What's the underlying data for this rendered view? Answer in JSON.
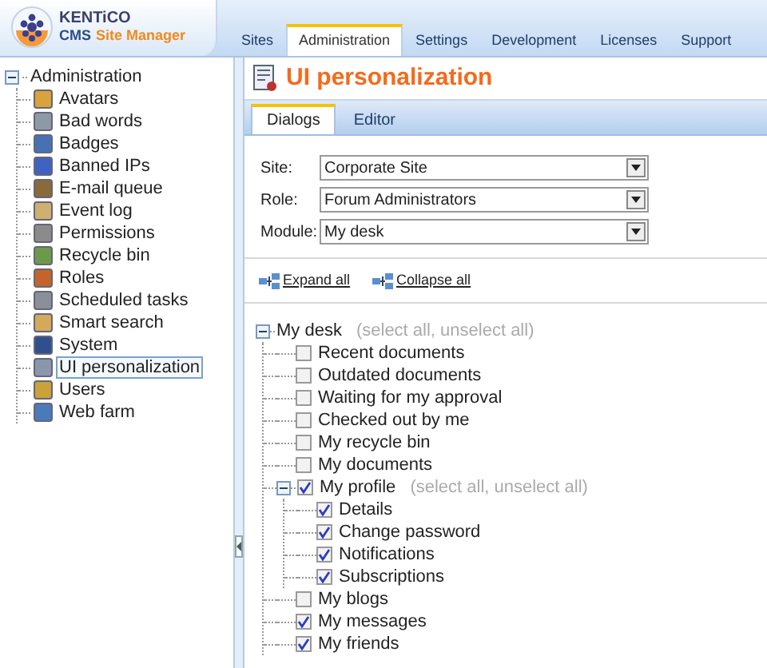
{
  "header": {
    "logo_line_1": "KENTiCO",
    "logo_line_2_a": "CMS",
    "logo_line_2_b": "Site Manager"
  },
  "main_tabs": [
    {
      "label": "Sites",
      "selected": false
    },
    {
      "label": "Administration",
      "selected": true
    },
    {
      "label": "Settings",
      "selected": false
    },
    {
      "label": "Development",
      "selected": false
    },
    {
      "label": "Licenses",
      "selected": false
    },
    {
      "label": "Support",
      "selected": false
    }
  ],
  "sidebar": {
    "root": "Administration",
    "expanded": true,
    "items": [
      {
        "label": "Avatars",
        "selected": false
      },
      {
        "label": "Bad words",
        "selected": false
      },
      {
        "label": "Badges",
        "selected": false
      },
      {
        "label": "Banned IPs",
        "selected": false
      },
      {
        "label": "E-mail queue",
        "selected": false
      },
      {
        "label": "Event log",
        "selected": false
      },
      {
        "label": "Permissions",
        "selected": false
      },
      {
        "label": "Recycle bin",
        "selected": false
      },
      {
        "label": "Roles",
        "selected": false
      },
      {
        "label": "Scheduled tasks",
        "selected": false
      },
      {
        "label": "Smart search",
        "selected": false
      },
      {
        "label": "System",
        "selected": false
      },
      {
        "label": "UI personalization",
        "selected": true
      },
      {
        "label": "Users",
        "selected": false
      },
      {
        "label": "Web farm",
        "selected": false
      }
    ]
  },
  "page_title": "UI personalization",
  "sub_tabs": [
    {
      "label": "Dialogs",
      "selected": true
    },
    {
      "label": "Editor",
      "selected": false
    }
  ],
  "form": [
    {
      "label": "Site:",
      "value": "Corporate Site"
    },
    {
      "label": "Role:",
      "value": "Forum Administrators"
    },
    {
      "label": "Module:",
      "value": "My desk"
    }
  ],
  "actions": [
    "Expand all",
    "Collapse all"
  ],
  "tree": {
    "label": "My desk",
    "expanded": true,
    "links": "(select all, unselect all)",
    "children": [
      {
        "label": "Recent documents",
        "checked": false
      },
      {
        "label": "Outdated documents",
        "checked": false
      },
      {
        "label": "Waiting for my approval",
        "checked": false
      },
      {
        "label": "Checked out by me",
        "checked": false
      },
      {
        "label": "My recycle bin",
        "checked": false
      },
      {
        "label": "My documents",
        "checked": false
      },
      {
        "label": "My profile",
        "checked": true,
        "expanded": true,
        "links": "(select all, unselect all)",
        "children": [
          {
            "label": "Details",
            "checked": true
          },
          {
            "label": "Change password",
            "checked": true
          },
          {
            "label": "Notifications",
            "checked": true
          },
          {
            "label": "Subscriptions",
            "checked": true
          }
        ]
      },
      {
        "label": "My blogs",
        "checked": false
      },
      {
        "label": "My messages",
        "checked": true
      },
      {
        "label": "My friends",
        "checked": true
      }
    ]
  }
}
